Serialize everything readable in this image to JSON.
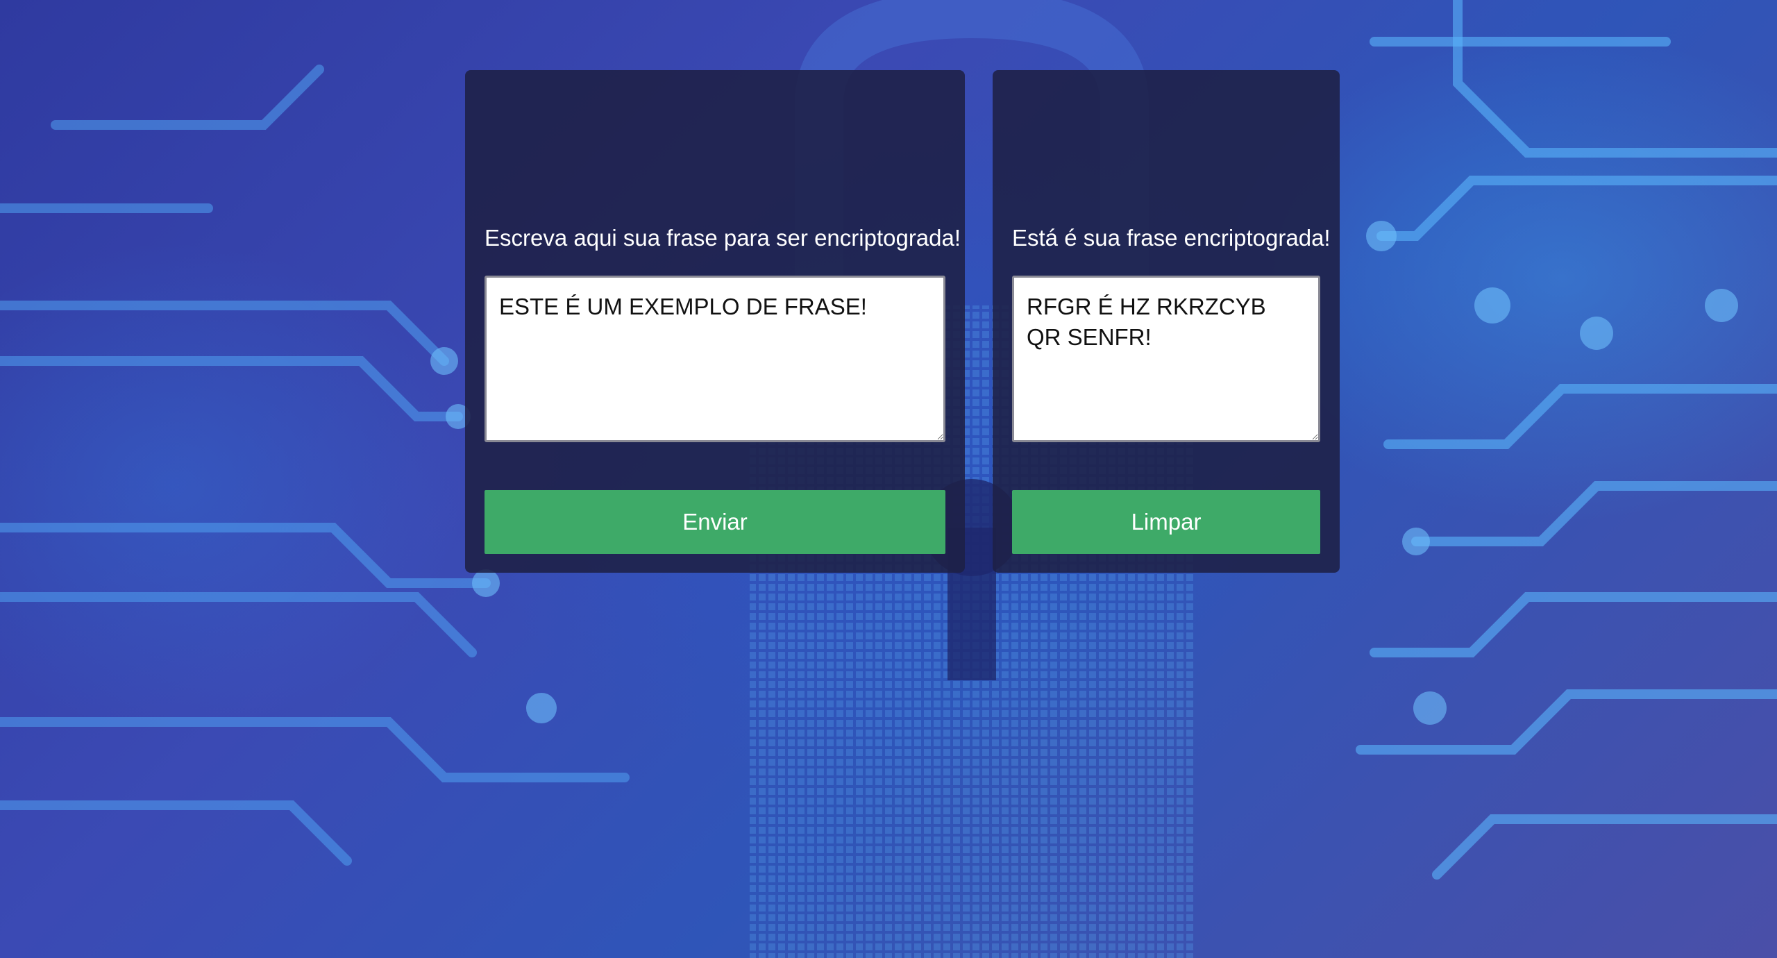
{
  "encrypt_panel": {
    "label": "Escreva aqui sua frase para ser encriptograda!",
    "input_value": "ESTE É UM EXEMPLO DE FRASE!",
    "button_label": "Enviar"
  },
  "result_panel": {
    "label": "Está é sua frase encriptograda!",
    "output_value": "RFGR É HZ RKRZCYB QR SENFR!",
    "button_label": "Limpar"
  },
  "colors": {
    "button": "#3eaa68",
    "panel": "#1e2046",
    "background": "#3b4ab4"
  }
}
